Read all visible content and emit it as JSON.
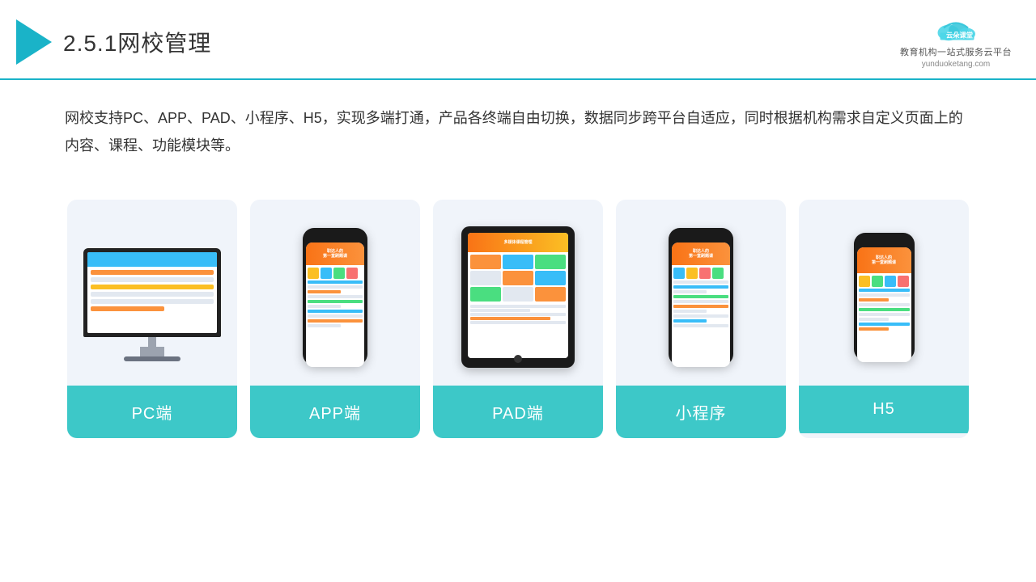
{
  "header": {
    "title_number": "2.5.1",
    "title_main": "网校管理",
    "logo_brand": "云朵课堂",
    "logo_url": "yunduoketang.com",
    "logo_tagline": "教育机构一站\n式服务云平台"
  },
  "description": {
    "text": "网校支持PC、APP、PAD、小程序、H5，实现多端打通，产品各终端自由切换，数据同步跨平台自适应，同时根据机构需求自定义页面上的内容、课程、功能模块等。"
  },
  "cards": [
    {
      "id": "pc",
      "label": "PC端"
    },
    {
      "id": "app",
      "label": "APP端"
    },
    {
      "id": "pad",
      "label": "PAD端"
    },
    {
      "id": "miniapp",
      "label": "小程序"
    },
    {
      "id": "h5",
      "label": "H5"
    }
  ],
  "colors": {
    "teal": "#3dc8c8",
    "accent": "#1ab3c8",
    "card_bg": "#f0f4fa"
  }
}
